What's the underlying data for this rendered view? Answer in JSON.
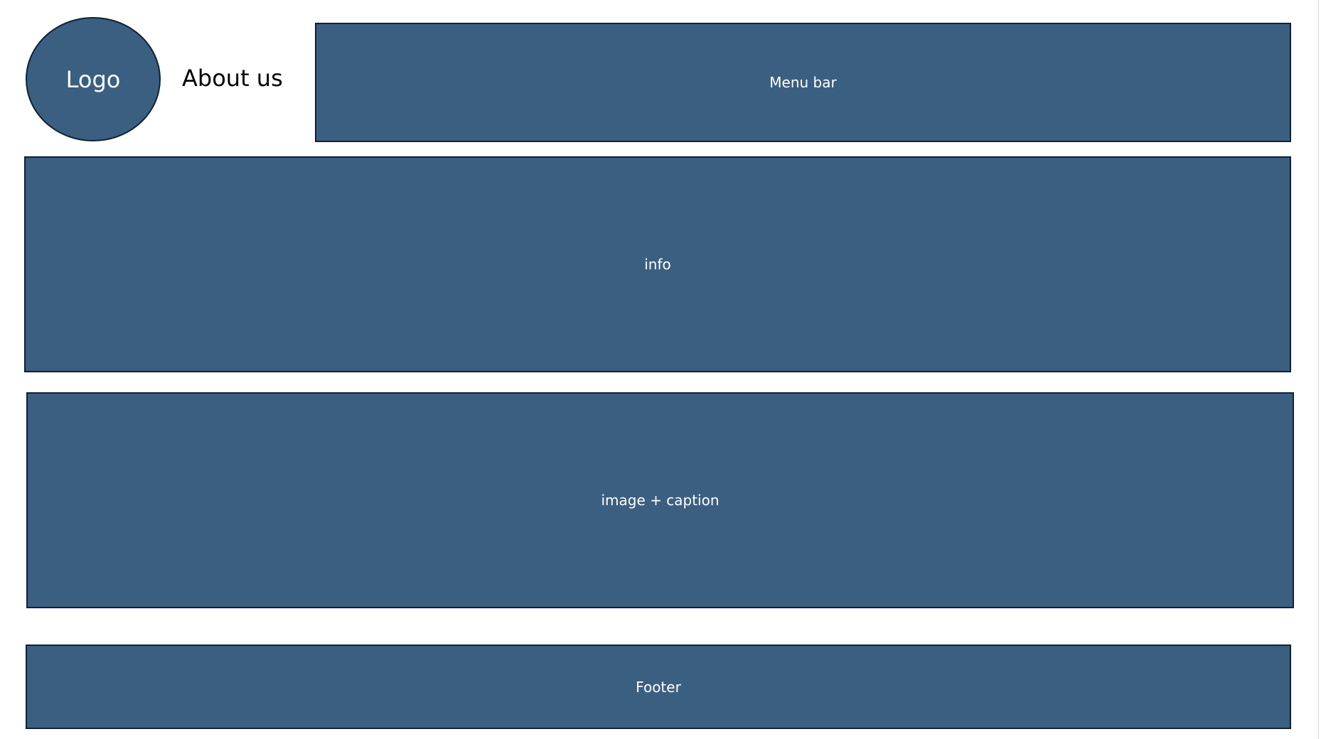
{
  "header": {
    "logo_label": "Logo",
    "page_title": "About us",
    "menu_bar_label": "Menu bar"
  },
  "main": {
    "info_label": "info",
    "image_caption_label": "image + caption"
  },
  "footer": {
    "label": "Footer"
  },
  "colors": {
    "block_fill": "#3b5f80",
    "block_border": "#0f2238",
    "block_text": "#ffffff",
    "background": "#ffffff",
    "title_text": "#000000"
  }
}
